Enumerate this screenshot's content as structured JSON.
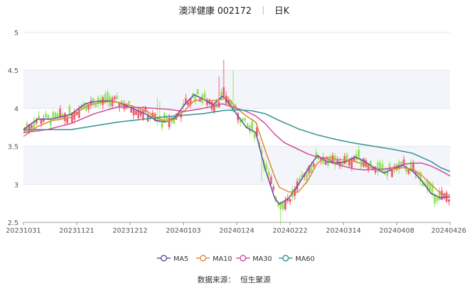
{
  "header": {
    "stock_name": "澳洋健康 002172",
    "period": "日K"
  },
  "footer": {
    "source_label": "数据来源：",
    "source_value": "恒生聚源"
  },
  "chart_data": {
    "type": "candlestick",
    "ylim": [
      2.5,
      5
    ],
    "yticks": [
      "2.5",
      "3",
      "3.5",
      "4",
      "4.5",
      "5"
    ],
    "xticks": [
      "20231031",
      "20231121",
      "20231212",
      "20240103",
      "20240124",
      "20240222",
      "20240314",
      "20240408",
      "20240426"
    ],
    "legend": [
      {
        "name": "MA5",
        "color": "#6a4fa3"
      },
      {
        "name": "MA10",
        "color": "#e08a3c"
      },
      {
        "name": "MA30",
        "color": "#d4509a"
      },
      {
        "name": "MA60",
        "color": "#3a9597"
      }
    ],
    "colors": {
      "up": "#ef5a6f",
      "down": "#8ee65a"
    },
    "ma_series": {
      "MA5": [
        [
          0,
          3.72
        ],
        [
          6,
          3.86
        ],
        [
          12,
          3.86
        ],
        [
          20,
          3.92
        ],
        [
          26,
          4.06
        ],
        [
          30,
          4.09
        ],
        [
          36,
          4.1
        ],
        [
          40,
          4.08
        ],
        [
          46,
          4.0
        ],
        [
          52,
          3.92
        ],
        [
          56,
          3.84
        ],
        [
          60,
          3.82
        ],
        [
          64,
          3.88
        ],
        [
          68,
          4.05
        ],
        [
          72,
          4.18
        ],
        [
          76,
          4.12
        ],
        [
          80,
          4.05
        ],
        [
          84,
          4.16
        ],
        [
          86,
          4.1
        ],
        [
          90,
          3.92
        ],
        [
          94,
          3.75
        ],
        [
          98,
          3.68
        ],
        [
          102,
          3.2
        ],
        [
          106,
          2.82
        ],
        [
          108,
          2.74
        ],
        [
          112,
          2.82
        ],
        [
          116,
          3.0
        ],
        [
          120,
          3.2
        ],
        [
          124,
          3.38
        ],
        [
          128,
          3.3
        ],
        [
          132,
          3.28
        ],
        [
          136,
          3.3
        ],
        [
          140,
          3.36
        ],
        [
          144,
          3.3
        ],
        [
          148,
          3.22
        ],
        [
          152,
          3.15
        ],
        [
          156,
          3.2
        ],
        [
          160,
          3.25
        ],
        [
          164,
          3.18
        ],
        [
          168,
          3.05
        ],
        [
          172,
          2.88
        ],
        [
          176,
          2.82
        ],
        [
          180,
          2.84
        ]
      ],
      "MA10": [
        [
          0,
          3.63
        ],
        [
          6,
          3.76
        ],
        [
          12,
          3.84
        ],
        [
          20,
          3.88
        ],
        [
          26,
          4.02
        ],
        [
          30,
          4.06
        ],
        [
          36,
          4.09
        ],
        [
          40,
          4.08
        ],
        [
          46,
          4.03
        ],
        [
          52,
          3.96
        ],
        [
          56,
          3.88
        ],
        [
          60,
          3.83
        ],
        [
          64,
          3.86
        ],
        [
          68,
          3.97
        ],
        [
          72,
          4.1
        ],
        [
          76,
          4.12
        ],
        [
          80,
          4.1
        ],
        [
          84,
          4.12
        ],
        [
          86,
          4.14
        ],
        [
          90,
          4.0
        ],
        [
          94,
          3.9
        ],
        [
          98,
          3.82
        ],
        [
          102,
          3.45
        ],
        [
          106,
          3.1
        ],
        [
          108,
          2.96
        ],
        [
          112,
          2.9
        ],
        [
          116,
          2.9
        ],
        [
          120,
          3.05
        ],
        [
          124,
          3.28
        ],
        [
          128,
          3.36
        ],
        [
          132,
          3.33
        ],
        [
          136,
          3.32
        ],
        [
          140,
          3.3
        ],
        [
          144,
          3.26
        ],
        [
          148,
          3.2
        ],
        [
          152,
          3.2
        ],
        [
          156,
          3.2
        ],
        [
          160,
          3.22
        ],
        [
          164,
          3.2
        ],
        [
          168,
          3.12
        ],
        [
          172,
          3.0
        ],
        [
          176,
          2.88
        ],
        [
          180,
          2.86
        ]
      ],
      "MA30": [
        [
          0,
          3.68
        ],
        [
          10,
          3.72
        ],
        [
          20,
          3.8
        ],
        [
          30,
          3.93
        ],
        [
          40,
          4.02
        ],
        [
          50,
          4.01
        ],
        [
          60,
          3.99
        ],
        [
          68,
          3.96
        ],
        [
          76,
          4.0
        ],
        [
          84,
          4.06
        ],
        [
          90,
          4.0
        ],
        [
          94,
          3.96
        ],
        [
          98,
          3.9
        ],
        [
          102,
          3.8
        ],
        [
          106,
          3.66
        ],
        [
          110,
          3.55
        ],
        [
          116,
          3.46
        ],
        [
          120,
          3.4
        ],
        [
          124,
          3.36
        ],
        [
          128,
          3.34
        ],
        [
          132,
          3.27
        ],
        [
          136,
          3.23
        ],
        [
          140,
          3.2
        ],
        [
          144,
          3.19
        ],
        [
          148,
          3.2
        ],
        [
          152,
          3.2
        ],
        [
          156,
          3.22
        ],
        [
          160,
          3.26
        ],
        [
          164,
          3.28
        ],
        [
          168,
          3.28
        ],
        [
          172,
          3.24
        ],
        [
          176,
          3.18
        ],
        [
          180,
          3.11
        ]
      ],
      "MA60": [
        [
          0,
          3.72
        ],
        [
          20,
          3.72
        ],
        [
          40,
          3.82
        ],
        [
          60,
          3.89
        ],
        [
          76,
          3.93
        ],
        [
          84,
          3.97
        ],
        [
          90,
          3.98
        ],
        [
          96,
          3.97
        ],
        [
          102,
          3.93
        ],
        [
          108,
          3.84
        ],
        [
          116,
          3.73
        ],
        [
          124,
          3.65
        ],
        [
          132,
          3.59
        ],
        [
          140,
          3.54
        ],
        [
          148,
          3.5
        ],
        [
          156,
          3.46
        ],
        [
          164,
          3.41
        ],
        [
          172,
          3.3
        ],
        [
          176,
          3.22
        ],
        [
          180,
          3.17
        ]
      ]
    }
  }
}
